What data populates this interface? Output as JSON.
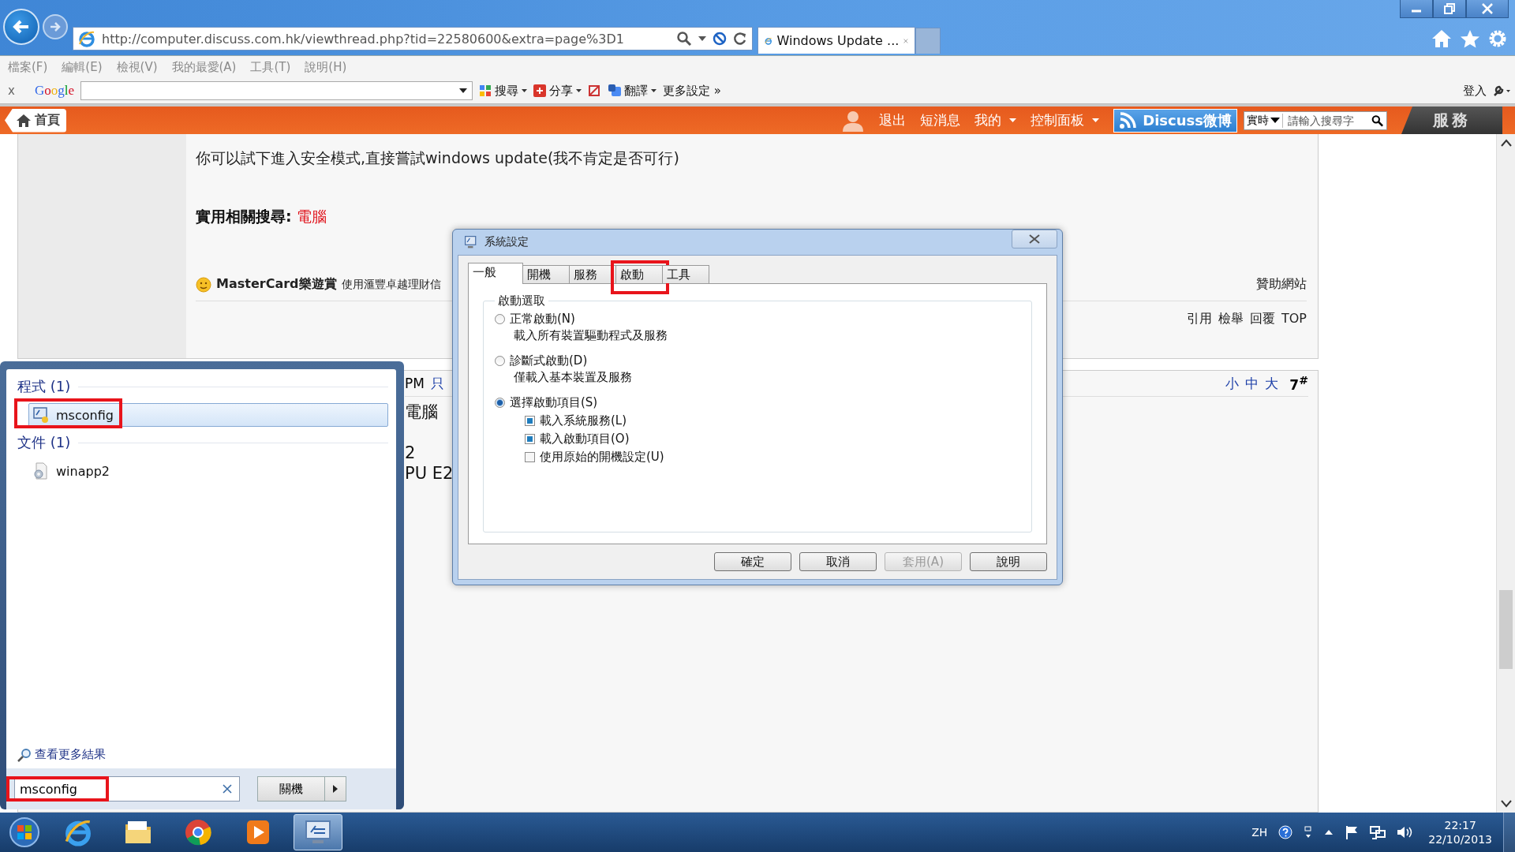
{
  "browser": {
    "address": "http://computer.discuss.com.hk/viewthread.php?tid=22580600&extra=page%3D1",
    "tabs": [
      {
        "label": "Windows Update ...",
        "selected": true
      }
    ],
    "menu": [
      "檔案(F)",
      "編輯(E)",
      "檢視(V)",
      "我的最愛(A)",
      "工具(T)",
      "說明(H)"
    ],
    "toolbar": {
      "close": "x",
      "logo": "Google",
      "buttons": [
        {
          "label": "搜尋",
          "kind": "search"
        },
        {
          "label": "分享",
          "kind": "share"
        },
        {
          "label": "翻譯",
          "kind": "translate"
        },
        {
          "label": "更多設定 »",
          "kind": "more"
        }
      ],
      "signin": "登入"
    }
  },
  "site_nav": {
    "home": "首頁",
    "links": [
      {
        "label": "退出",
        "dropdown": false
      },
      {
        "label": "短消息",
        "dropdown": false
      },
      {
        "label": "我的",
        "dropdown": true
      },
      {
        "label": "控制面板",
        "dropdown": true
      }
    ],
    "banner": "Discuss微博",
    "search": {
      "scope": "實時",
      "placeholder": "請輸入搜尋字"
    },
    "service": "服務"
  },
  "post": {
    "body": "你可以試下進入安全模式,直接嘗試windows update(我不肯定是否可行)",
    "related_label": "實用相關搜尋:",
    "related_link": "電腦",
    "ad_title": "MasterCard樂遊賞",
    "ad_text": "使用滙豐卓越理財信",
    "sponsor": "贊助網站",
    "actions": [
      "引用",
      "檢舉",
      "回覆",
      "TOP"
    ]
  },
  "post2": {
    "time": "PM",
    "only": "只",
    "font_sizes": [
      "小",
      "中",
      "大"
    ],
    "floor": "7$^{#}$",
    "lines": [
      "電腦",
      "2",
      "PU E2"
    ]
  },
  "dialog": {
    "title": "系統設定",
    "tabs": [
      {
        "label": "一般",
        "selected": true,
        "highlighted": false
      },
      {
        "label": "開機",
        "selected": false,
        "highlighted": false
      },
      {
        "label": "服務",
        "selected": false,
        "highlighted": false
      },
      {
        "label": "啟動",
        "selected": false,
        "highlighted": true
      },
      {
        "label": "工具",
        "selected": false,
        "highlighted": false
      }
    ],
    "group": "啟動選取",
    "options": [
      {
        "label": "正常啟動(N)",
        "desc": "載入所有裝置驅動程式及服務",
        "selected": false
      },
      {
        "label": "診斷式啟動(D)",
        "desc": "僅載入基本裝置及服務",
        "selected": false
      },
      {
        "label": "選擇啟動項目(S)",
        "selected": true,
        "checks": [
          {
            "label": "載入系統服務(L)",
            "checked": true
          },
          {
            "label": "載入啟動項目(O)",
            "checked": true
          },
          {
            "label": "使用原始的開機設定(U)",
            "checked": false
          }
        ]
      }
    ],
    "buttons": [
      {
        "label": "確定",
        "disabled": false
      },
      {
        "label": "取消",
        "disabled": false
      },
      {
        "label": "套用(A)",
        "disabled": true
      },
      {
        "label": "說明",
        "disabled": false
      }
    ]
  },
  "start_menu": {
    "sections": [
      {
        "title": "程式 (1)",
        "items": [
          {
            "label": "msconfig",
            "selected": true,
            "highlighted": true,
            "kind": "program"
          }
        ]
      },
      {
        "title": "文件 (1)",
        "items": [
          {
            "label": "winapp2",
            "selected": false,
            "highlighted": false,
            "kind": "file"
          }
        ]
      }
    ],
    "more": "查看更多結果",
    "search": {
      "value": "msconfig",
      "highlighted": true
    },
    "shutdown": "關機"
  },
  "taskbar": {
    "apps": [
      {
        "kind": "ie",
        "selected": false
      },
      {
        "kind": "explorer",
        "selected": false
      },
      {
        "kind": "chrome",
        "selected": false
      },
      {
        "kind": "media",
        "selected": false
      },
      {
        "kind": "msconfig",
        "selected": true
      }
    ],
    "lang": "ZH",
    "time": "22:17",
    "date": "22/10/2013"
  }
}
